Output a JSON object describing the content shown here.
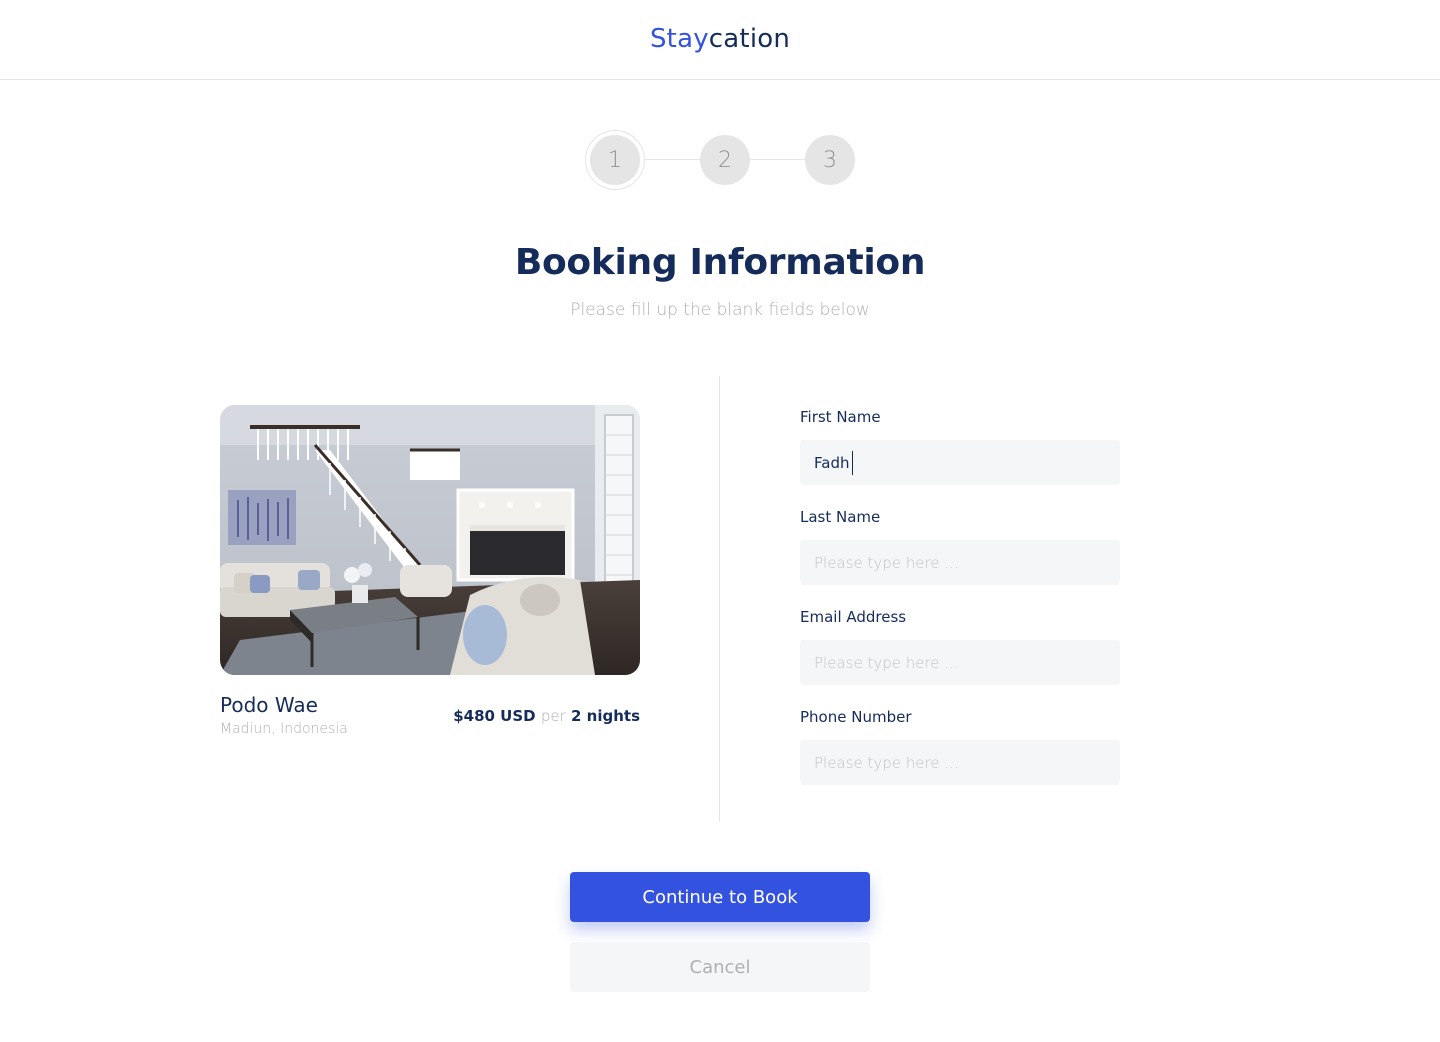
{
  "brand": {
    "part1": "Stay",
    "part2": "cation"
  },
  "stepper": {
    "steps": [
      "1",
      "2",
      "3"
    ],
    "active_step": 1
  },
  "page": {
    "title": "Booking Information",
    "subtitle": "Please fill up the blank fields below"
  },
  "property": {
    "name": "Podo Wae",
    "location": "Madiun, Indonesia",
    "price": "$480 USD",
    "per": "per",
    "duration": "2 nights"
  },
  "form": {
    "first_name": {
      "label": "First Name",
      "value": "Fadh",
      "placeholder": "Please type here ..."
    },
    "last_name": {
      "label": "Last Name",
      "value": "",
      "placeholder": "Please type here ..."
    },
    "email": {
      "label": "Email Address",
      "value": "",
      "placeholder": "Please type here ..."
    },
    "phone": {
      "label": "Phone Number",
      "value": "",
      "placeholder": "Please type here ..."
    }
  },
  "actions": {
    "continue_label": "Continue to Book",
    "cancel_label": "Cancel"
  },
  "colors": {
    "accent": "#3252df",
    "navy": "#152c5b",
    "muted": "#b0b0b0",
    "field_bg": "#f5f6f8"
  }
}
